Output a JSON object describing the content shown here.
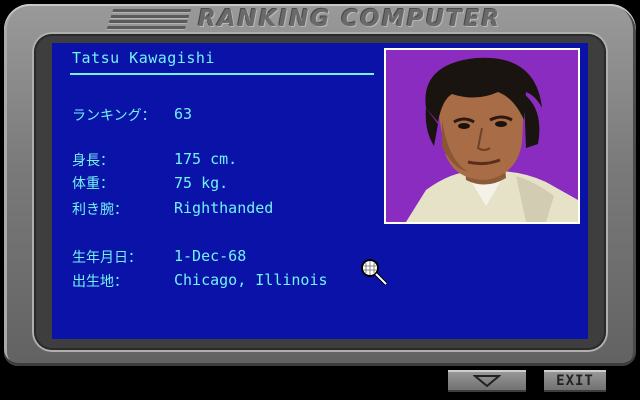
{
  "header": {
    "title": "RANKING COMPUTER"
  },
  "player": {
    "name": "Tatsu Kawagishi",
    "ranking_label": "ランキング：",
    "ranking_value": "63",
    "height_label": "身長：",
    "height_value": "175 cm.",
    "weight_label": "体重：",
    "weight_value": "75 kg.",
    "hand_label": "利き腕：",
    "hand_value": "Righthanded",
    "birth_label": "生年月日：",
    "birth_value": "1-Dec-68",
    "birthplace_label": "出生地：",
    "birthplace_value": "Chicago, Illinois"
  },
  "controls": {
    "exit_label": "EXIT"
  },
  "colors": {
    "screen_bg": "#0a12a8",
    "text": "#6ff3f3",
    "photo_bg": "#8a2cc0",
    "bezel": "#7a7a7a"
  },
  "icons": {
    "logo": "ea-logo-icon",
    "pointer": "tennis-racket-icon",
    "down": "triangle-down-icon"
  }
}
